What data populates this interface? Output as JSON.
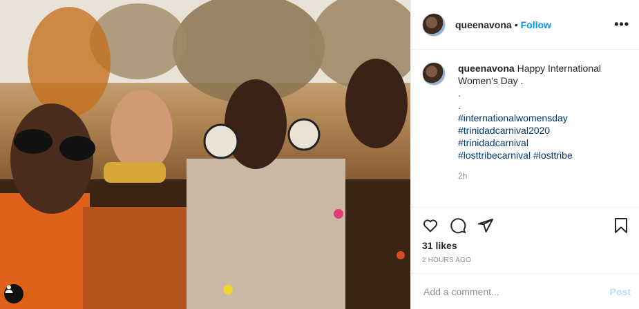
{
  "header": {
    "username": "queenavona",
    "separator": "•",
    "follow_label": "Follow",
    "more_label": "•••"
  },
  "caption": {
    "username": "queenavona",
    "text": "Happy International Women’s Day .",
    "dot1": ".",
    "dot2": ".",
    "hashtags": [
      "#internationalwomensday",
      "#trinidadcarnival2020",
      "#trinidadcarnival",
      "#losttribecarnival #losttribe"
    ],
    "time": "2h"
  },
  "actions": {
    "icons": [
      "heart-icon",
      "comment-icon",
      "share-icon",
      "bookmark-icon"
    ]
  },
  "likes": "31 likes",
  "posted_ago": "2 HOURS AGO",
  "comment": {
    "placeholder": "Add a comment...",
    "post_label": "Post"
  },
  "colors": {
    "link": "#0095f6",
    "hashtag": "#00376b",
    "muted": "#8e8e8e",
    "post_disabled": "#b2dffc"
  }
}
